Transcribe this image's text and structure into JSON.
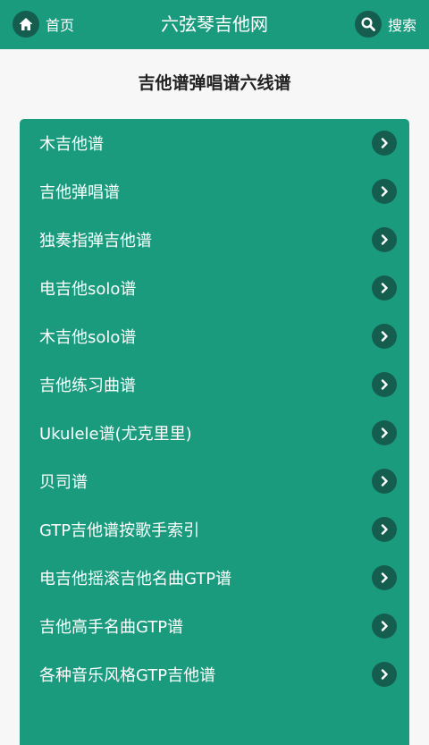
{
  "header": {
    "home_label": "首页",
    "title": "六弦琴吉他网",
    "search_label": "搜索",
    "bg_color": "#1a9b7e"
  },
  "heading": "吉他谱弹唱谱六线谱",
  "menu": [
    {
      "label": "木吉他谱"
    },
    {
      "label": "吉他弹唱谱"
    },
    {
      "label": "独奏指弹吉他谱"
    },
    {
      "label": "电吉他solo谱"
    },
    {
      "label": "木吉他solo谱"
    },
    {
      "label": "吉他练习曲谱"
    },
    {
      "label": "Ukulele谱(尤克里里)"
    },
    {
      "label": "贝司谱"
    },
    {
      "label": "GTP吉他谱按歌手索引"
    },
    {
      "label": "电吉他摇滚吉他名曲GTP谱"
    },
    {
      "label": "吉他高手名曲GTP谱"
    },
    {
      "label": "各种音乐风格GTP吉他谱"
    }
  ],
  "icons": {
    "home": "home-icon",
    "search": "search-icon",
    "item_arrow": "chevron-right-icon"
  }
}
